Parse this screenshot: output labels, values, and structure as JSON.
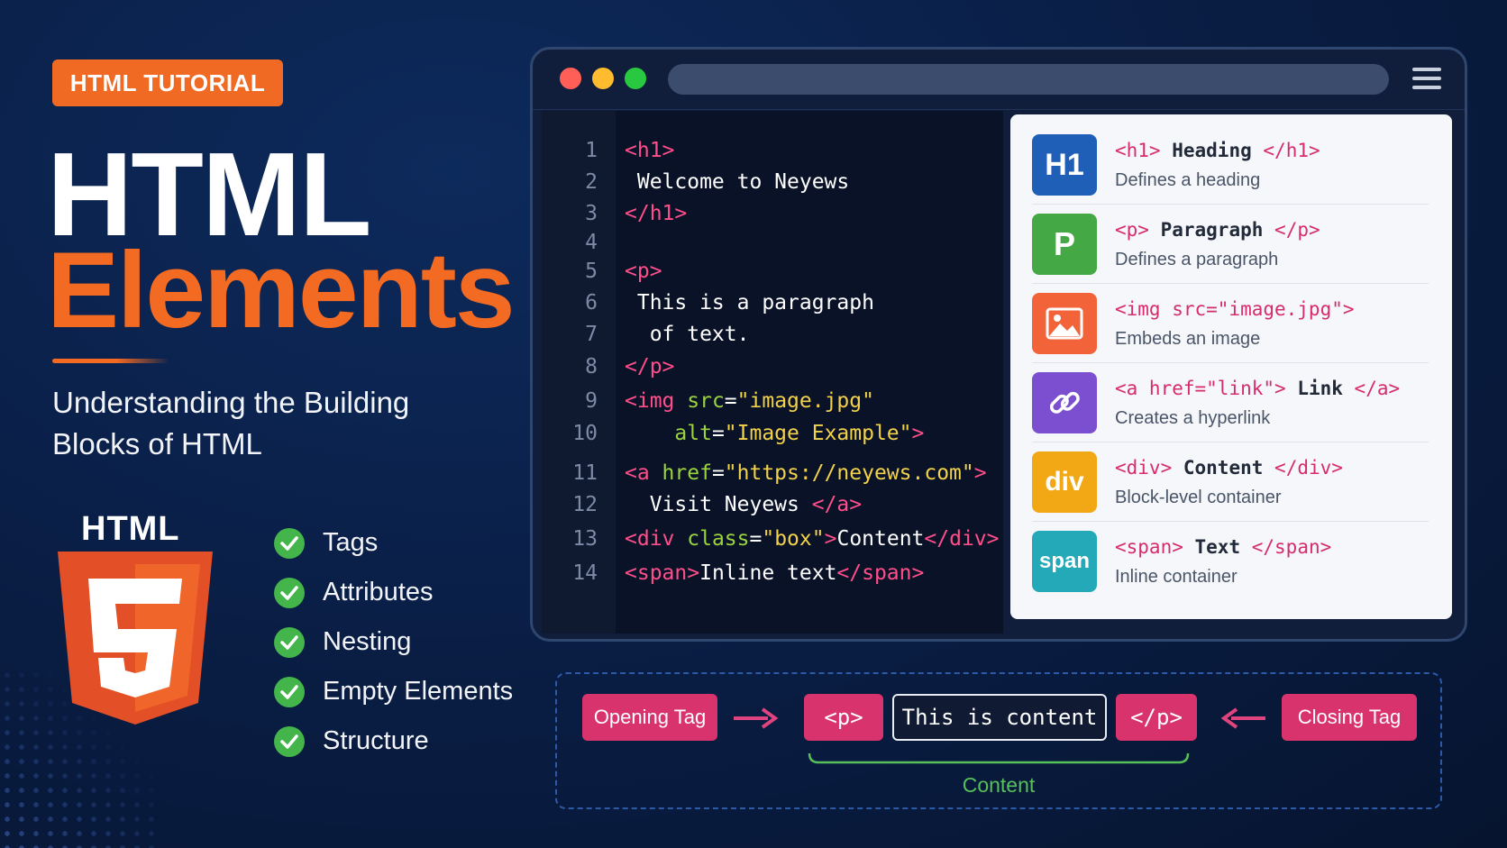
{
  "badge": "HTML TUTORIAL",
  "title": {
    "line1": "HTML",
    "line2": "Elements"
  },
  "subtitle": {
    "line1": "Understanding the Building",
    "line2": "Blocks of HTML"
  },
  "logo": {
    "word": "HTML",
    "number": "5",
    "icon": "html5-shield-icon"
  },
  "checklist": [
    "Tags",
    "Attributes",
    "Nesting",
    "Empty Elements",
    "Structure"
  ],
  "colors": {
    "accent_orange": "#f36a22",
    "check_green": "#43b54a",
    "tag_pink": "#ff4f8a",
    "attr_green": "#9bd43d",
    "string_yellow": "#f2d24a"
  },
  "browser": {
    "traffic_lights": [
      "#ff5f57",
      "#febc2e",
      "#28c840"
    ],
    "menu_icon": "hamburger-menu-icon"
  },
  "code": {
    "line_numbers": [
      "1",
      "2",
      "3",
      "4",
      "5",
      "6",
      "7",
      "8",
      "9",
      "10",
      "11",
      "12",
      "13",
      "14"
    ],
    "lines": [
      [
        {
          "k": "t",
          "v": "<h1>"
        }
      ],
      [
        {
          "k": "w",
          "v": " Welcome to Neyews"
        }
      ],
      [
        {
          "k": "t",
          "v": "</h1>"
        }
      ],
      [],
      [
        {
          "k": "t",
          "v": "<p>"
        }
      ],
      [
        {
          "k": "w",
          "v": " This is a paragraph"
        }
      ],
      [
        {
          "k": "w",
          "v": "  of text."
        }
      ],
      [
        {
          "k": "t",
          "v": "</p>"
        }
      ],
      [
        {
          "k": "t",
          "v": "<img "
        },
        {
          "k": "a",
          "v": "src"
        },
        {
          "k": "w",
          "v": "="
        },
        {
          "k": "s",
          "v": "\"image.jpg\""
        }
      ],
      [
        {
          "k": "a",
          "v": "    alt"
        },
        {
          "k": "w",
          "v": "="
        },
        {
          "k": "s",
          "v": "\"Image Example\""
        },
        {
          "k": "t",
          "v": ">"
        }
      ],
      [
        {
          "k": "t",
          "v": "<a "
        },
        {
          "k": "a",
          "v": "href"
        },
        {
          "k": "w",
          "v": "="
        },
        {
          "k": "s",
          "v": "\"https://neyews.com\""
        },
        {
          "k": "t",
          "v": ">"
        }
      ],
      [
        {
          "k": "w",
          "v": "  Visit Neyews "
        },
        {
          "k": "t",
          "v": "</a>"
        }
      ],
      [
        {
          "k": "t",
          "v": "<div "
        },
        {
          "k": "a",
          "v": "class"
        },
        {
          "k": "w",
          "v": "="
        },
        {
          "k": "s",
          "v": "\"box\""
        },
        {
          "k": "t",
          "v": ">"
        },
        {
          "k": "w",
          "v": "Content"
        },
        {
          "k": "t",
          "v": "</div>"
        }
      ],
      [
        {
          "k": "t",
          "v": "<span>"
        },
        {
          "k": "w",
          "v": "Inline text"
        },
        {
          "k": "t",
          "v": "</span>"
        }
      ]
    ]
  },
  "reference": [
    {
      "icon_label": "H1",
      "icon_color": "#1f5fb8",
      "open": "<h1>",
      "name": "Heading",
      "close": "</h1>",
      "desc": "Defines a heading"
    },
    {
      "icon_label": "P",
      "icon_color": "#44a845",
      "open": "<p>",
      "name": "Paragraph",
      "close": "</p>",
      "desc": "Defines a paragraph"
    },
    {
      "icon_label": "",
      "icon_name": "image-icon",
      "icon_color": "#f2633a",
      "open": "<img src=\"image.jpg\">",
      "name": "",
      "close": "",
      "desc": "Embeds an image"
    },
    {
      "icon_label": "",
      "icon_name": "link-icon",
      "icon_color": "#7b4fd0",
      "open": "<a href=\"link\">",
      "name": "Link",
      "close": "</a>",
      "desc": "Creates a hyperlink"
    },
    {
      "icon_label": "div",
      "icon_color": "#f2a815",
      "open": "<div>",
      "name": "Content",
      "close": "</div>",
      "desc": "Block-level container"
    },
    {
      "icon_label": "span",
      "icon_color": "#23a9b8",
      "open": "<span>",
      "name": "Text",
      "close": "</span>",
      "desc": "Inline container"
    }
  ],
  "anatomy": {
    "opening_tag_label": "Opening Tag",
    "open_tag": "<p>",
    "content": "This is content",
    "close_tag": "</p>",
    "closing_tag_label": "Closing Tag",
    "content_label": "Content"
  }
}
